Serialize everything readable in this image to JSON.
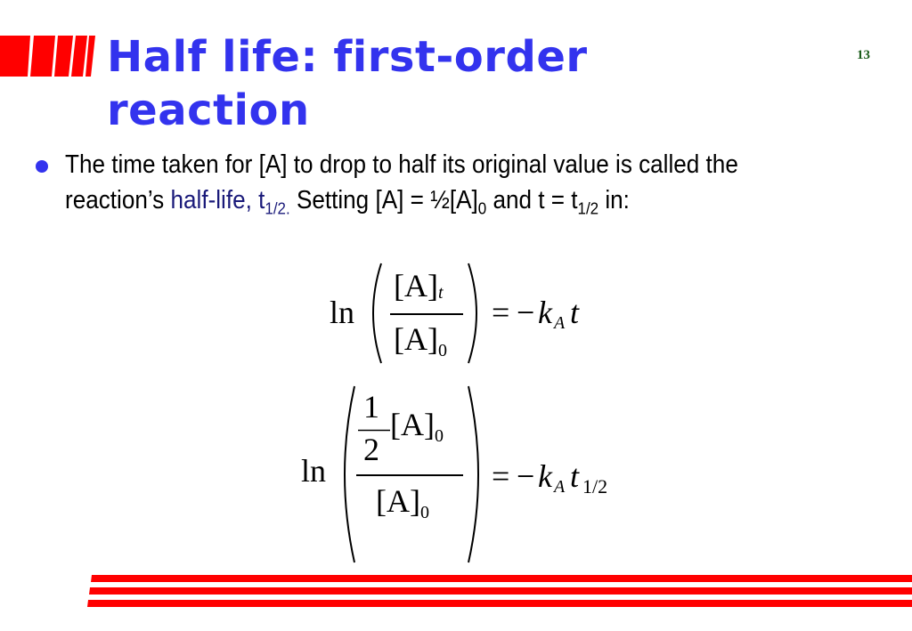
{
  "slide": {
    "title_line1": "Half life: first-order",
    "title_line2": "reaction",
    "page_number": "13",
    "accent_color": "#3333ee",
    "deco_color": "#ff0000"
  },
  "bullet": {
    "line1": "The time taken for [A] to drop to half its original value is called the",
    "line2_prefix": "reaction’s ",
    "highlight": "half-life, t",
    "highlight_sub": "1/2.",
    "mid": " Setting [A] = ½[A]",
    "mid_sub": "0",
    "tail": " and t = t",
    "tail_sub": "1/2",
    "end": " in:"
  },
  "equation1": {
    "ln": "ln",
    "num": "[A]",
    "num_sub": "t",
    "den": "[A]",
    "den_sub": "0",
    "equals": "=",
    "rhs_minus": "−",
    "rhs_k": "k",
    "rhs_k_sub": "A",
    "rhs_t": "t"
  },
  "equation2": {
    "ln": "ln",
    "frac_num": "1",
    "frac_den": "2",
    "num": "[A]",
    "num_sub": "0",
    "den": "[A]",
    "den_sub": "0",
    "equals": "=",
    "rhs_minus": "−",
    "rhs_k": "k",
    "rhs_k_sub": "A",
    "rhs_t": "t",
    "rhs_t_sub": "1/2"
  }
}
